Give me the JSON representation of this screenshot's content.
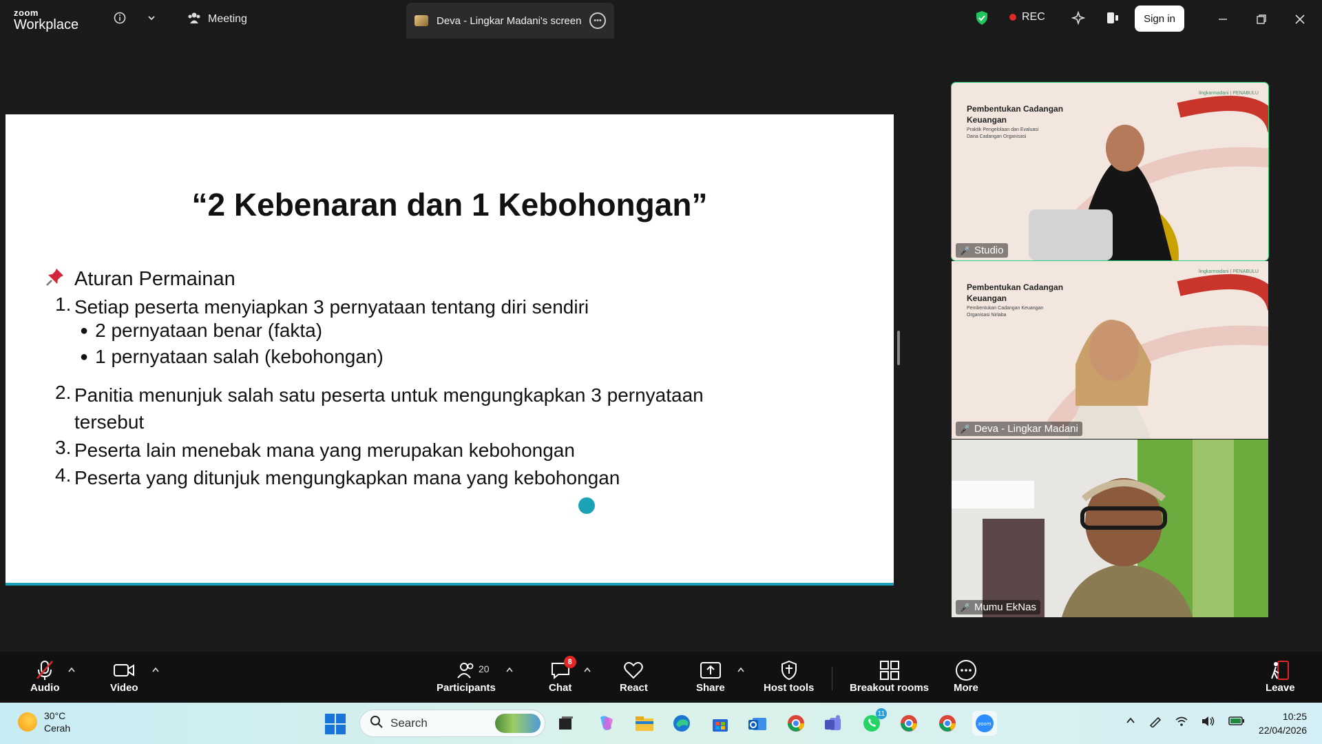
{
  "titlebar": {
    "logo_top": "zoom",
    "logo_bottom": "Workplace",
    "meeting_label": "Meeting",
    "share_tab_label": "Deva - Lingkar Madani's screen",
    "rec_label": "REC",
    "signin_label": "Sign in"
  },
  "slide": {
    "title": "“2 Kebenaran dan 1 Kebohongan”",
    "rules_heading": "Aturan Permainan",
    "rules": [
      {
        "num": "1.",
        "text": "Setiap peserta menyiapkan 3 pernyataan tentang diri sendiri"
      },
      {
        "num": "2.",
        "text": "Panitia menunjuk salah satu peserta untuk mengungkapkan 3 pernyataan tersebut"
      },
      {
        "num": "3.",
        "text": "Peserta lain menebak mana yang merupakan kebohongan"
      },
      {
        "num": "4.",
        "text": "Peserta yang ditunjuk mengungkapkan mana yang kebohongan"
      }
    ],
    "sub_bullets": [
      "2 pernyataan benar (fakta)",
      "1 pernyataan salah (kebohongan)"
    ]
  },
  "videos": [
    {
      "name": "Studio",
      "title": "Pembentukan Cadangan Keuangan",
      "subtitle": "Praktik Pengelolaan dan Evaluasi Dana Cadangan Organisasi",
      "brand": "lingkarmadani  |  PENABULU"
    },
    {
      "name": "Deva - Lingkar Madani",
      "title": "Pembentukan Cadangan Keuangan",
      "subtitle": "Pembentukan Cadangan Keuangan Organisasi Nirlaba",
      "brand": "lingkarmadani  |  PENABULU"
    },
    {
      "name": "Mumu EkNas"
    }
  ],
  "toolbar": {
    "audio": "Audio",
    "video": "Video",
    "participants": "Participants",
    "participants_count": "20",
    "chat": "Chat",
    "chat_badge": "8",
    "react": "React",
    "share": "Share",
    "host_tools": "Host tools",
    "breakout": "Breakout rooms",
    "more": "More",
    "leave": "Leave"
  },
  "taskbar": {
    "temp": "30°C",
    "weather": "Cerah",
    "search_placeholder": "Search",
    "teams_badge": "11",
    "time": "10:25",
    "date": "22/04/2026"
  },
  "colors": {
    "active_speaker": "#27d07a",
    "rec": "#e02828",
    "slide_accent": "#1aa3b6"
  }
}
